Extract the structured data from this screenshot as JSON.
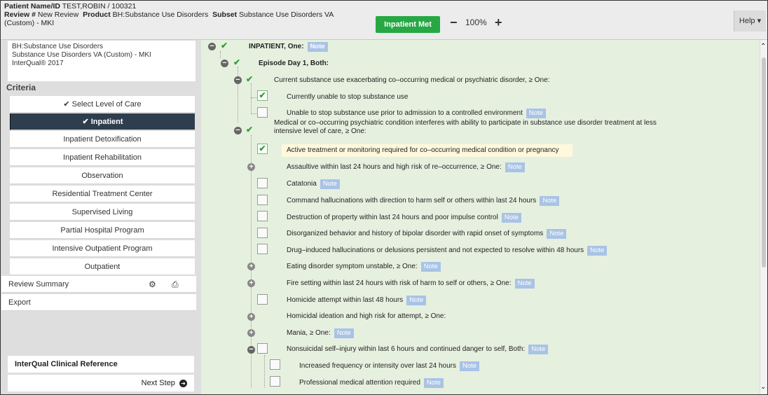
{
  "header": {
    "patient_label": "Patient Name/ID",
    "patient_value": "TEST,ROBIN / 100321",
    "review_label": "Review #",
    "review_value": "New Review",
    "product_label": "Product",
    "product_value": "BH:Substance Use Disorders",
    "subset_label": "Subset",
    "subset_value": "Substance Use Disorders VA",
    "subset_value_line2": "(Custom) - MKI",
    "status_button": "Inpatient Met",
    "zoom_minus": "−",
    "zoom_value": "100%",
    "zoom_plus": "+",
    "help_label": "Help ▾",
    "status_color": "#27a844"
  },
  "left": {
    "subset_lines": [
      "BH:Substance Use Disorders",
      "Substance Use Disorders VA (Custom) - MKI",
      "InterQual® 2017"
    ],
    "criteria_label": "Criteria",
    "select_level": "✔ Select Level of Care",
    "levels": [
      {
        "label": "✔ Inpatient",
        "selected": true
      },
      {
        "label": "Inpatient Detoxification"
      },
      {
        "label": "Inpatient Rehabilitation"
      },
      {
        "label": "Observation"
      },
      {
        "label": "Residential Treatment Center"
      },
      {
        "label": "Supervised Living"
      },
      {
        "label": "Partial Hospital Program"
      },
      {
        "label": "Intensive Outpatient Program"
      },
      {
        "label": "Outpatient"
      }
    ],
    "review_summary": "Review Summary",
    "export": "Export",
    "reference": "InterQual Clinical Reference",
    "next_step": "Next Step",
    "selected_color": "#2f3e4e"
  },
  "criteria": [
    {
      "text": "INPATIENT, One:",
      "note": "Note"
    },
    {
      "text": "Episode Day 1, Both:"
    },
    {
      "text": "Current substance use exacerbating co–occurring medical or psychiatric disorder, ≥ One:"
    },
    {
      "text": "Currently unable to stop substance use"
    },
    {
      "text": "Unable to stop substance use prior to admission to a controlled environment",
      "note": "Note"
    },
    {
      "text": "Medical or co–occurring psychiatric condition interferes with ability to participate in substance use disorder treatment at less",
      "text2": "intensive level of care, ≥ One:"
    },
    {
      "text": "Active treatment or monitoring required for co–occurring medical condition or pregnancy"
    },
    {
      "text": "Assaultive within last 24 hours and high risk of re–occurrence, ≥ One:",
      "note": "Note"
    },
    {
      "text": "Catatonia",
      "note": "Note"
    },
    {
      "text": "Command hallucinations with direction to harm self or others within last 24 hours",
      "note": "Note"
    },
    {
      "text": "Destruction of property within last 24 hours and poor impulse control",
      "note": "Note"
    },
    {
      "text": "Disorganized behavior and history of bipolar disorder with rapid onset of symptoms",
      "note": "Note"
    },
    {
      "text": "Drug–induced hallucinations or delusions persistent and not expected to resolve within 48 hours",
      "note": "Note"
    },
    {
      "text": "Eating disorder symptom unstable, ≥ One:",
      "note": "Note"
    },
    {
      "text": "Fire setting within last 24 hours with risk of harm to self or others, ≥ One:",
      "note": "Note"
    },
    {
      "text": "Homicide attempt within last 48 hours",
      "note": "Note"
    },
    {
      "text": "Homicidal ideation and high risk for attempt, ≥ One:"
    },
    {
      "text": "Mania, ≥ One:",
      "note": "Note"
    },
    {
      "text": "Nonsuicidal self–injury within last 6 hours and continued danger to self, Both:",
      "note": "Note"
    },
    {
      "text": "Increased frequency or intensity over last 24 hours",
      "note": "Note"
    },
    {
      "text": "Professional medical attention required",
      "note": "Note"
    }
  ]
}
